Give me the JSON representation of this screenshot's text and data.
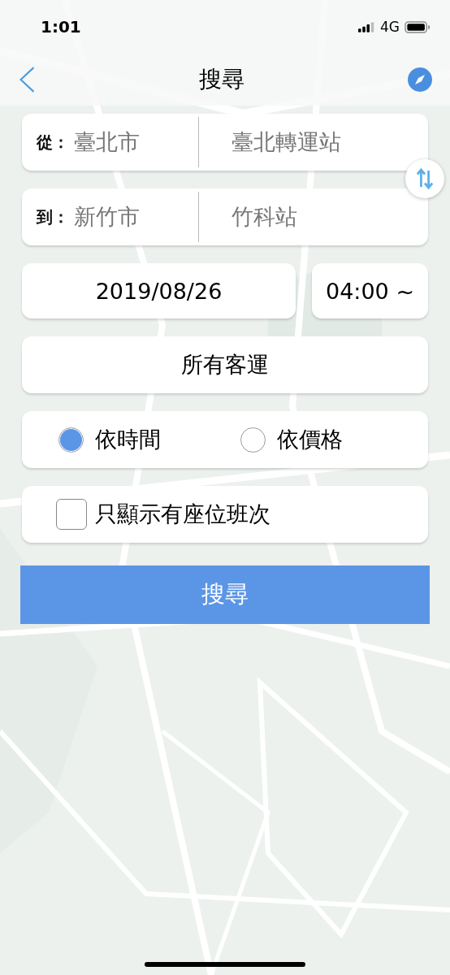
{
  "status_bar": {
    "time": "1:01",
    "network": "4G"
  },
  "nav": {
    "title": "搜尋"
  },
  "route": [
    {
      "label": "從：",
      "city": "臺北市",
      "station": "臺北轉運站"
    },
    {
      "label": "到：",
      "city": "新竹市",
      "station": "竹科站"
    }
  ],
  "date": "2019/08/26",
  "time": "04:00 ~",
  "carrier": "所有客運",
  "sort_options": [
    {
      "label": "依時間",
      "selected": true
    },
    {
      "label": "依價格",
      "selected": false
    }
  ],
  "seat_filter": {
    "label": "只顯示有座位班次",
    "checked": false
  },
  "search_button": "搜尋"
}
